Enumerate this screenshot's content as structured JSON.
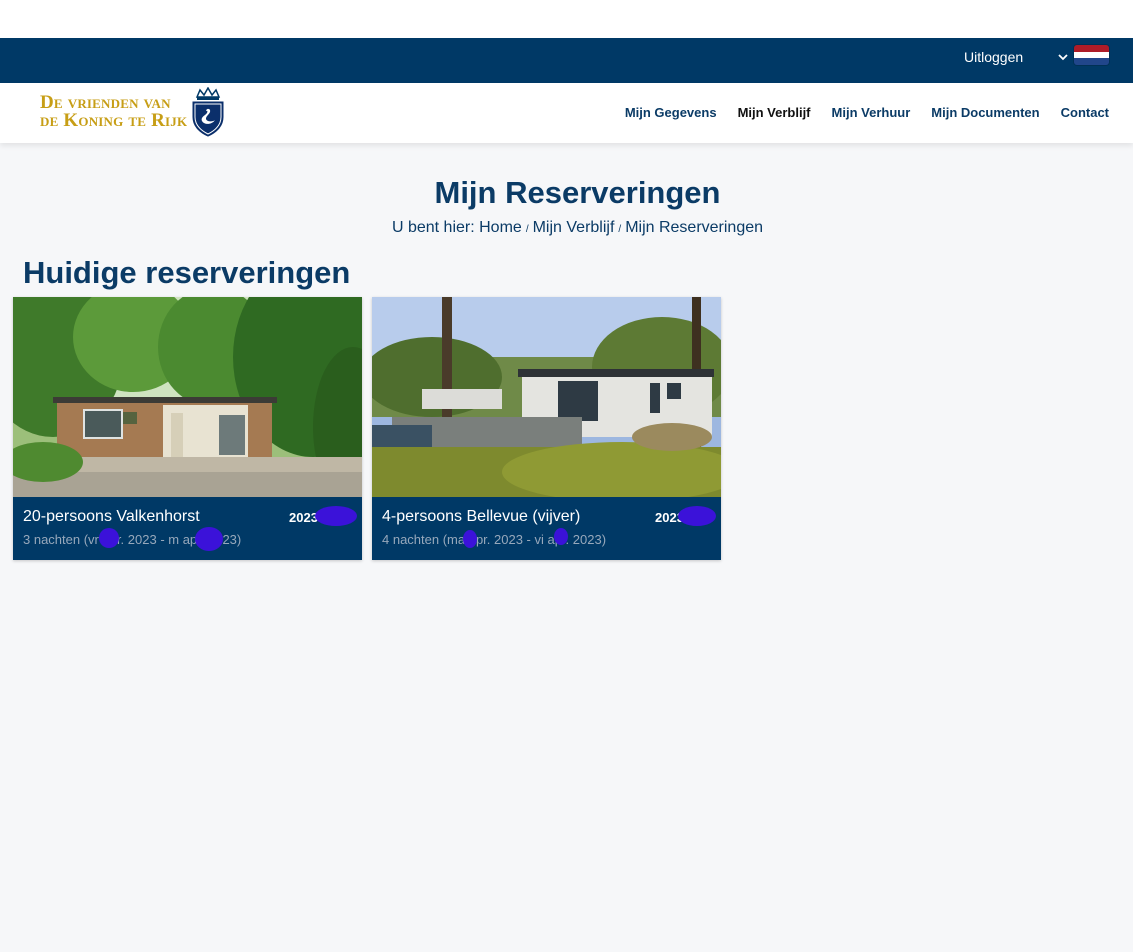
{
  "topbar": {
    "logout_label": "Uitloggen",
    "language_flag": "netherlands-flag",
    "flag_colors": [
      "#ae1c28",
      "#ffffff",
      "#21468b"
    ]
  },
  "brand": {
    "line1": "De vrienden van",
    "line2": "de Koning te Rijk",
    "gold": "#c79e16",
    "navy": "#003966"
  },
  "nav": [
    {
      "label": "Mijn Gegevens",
      "active": false
    },
    {
      "label": "Mijn Verblijf",
      "active": true
    },
    {
      "label": "Mijn Verhuur",
      "active": false
    },
    {
      "label": "Mijn Documenten",
      "active": false
    },
    {
      "label": "Contact",
      "active": false
    }
  ],
  "page": {
    "title": "Mijn Reserveringen",
    "breadcrumb_prefix": "U bent hier:",
    "breadcrumb": [
      "Home",
      "Mijn Verblijf",
      "Mijn Reserveringen"
    ],
    "breadcrumb_separator": "/"
  },
  "section_title": "Huidige reserveringen",
  "reservations": [
    {
      "name": "20-persoons Valkenhorst",
      "year": "2023",
      "dates": "3 nachten (vr apr. 2023 - m apr. 2023)"
    },
    {
      "name": "4-persoons Bellevue (vijver)",
      "year": "2023",
      "dates": "4 nachten (ma apr. 2023 - vi apr. 2023)"
    }
  ]
}
